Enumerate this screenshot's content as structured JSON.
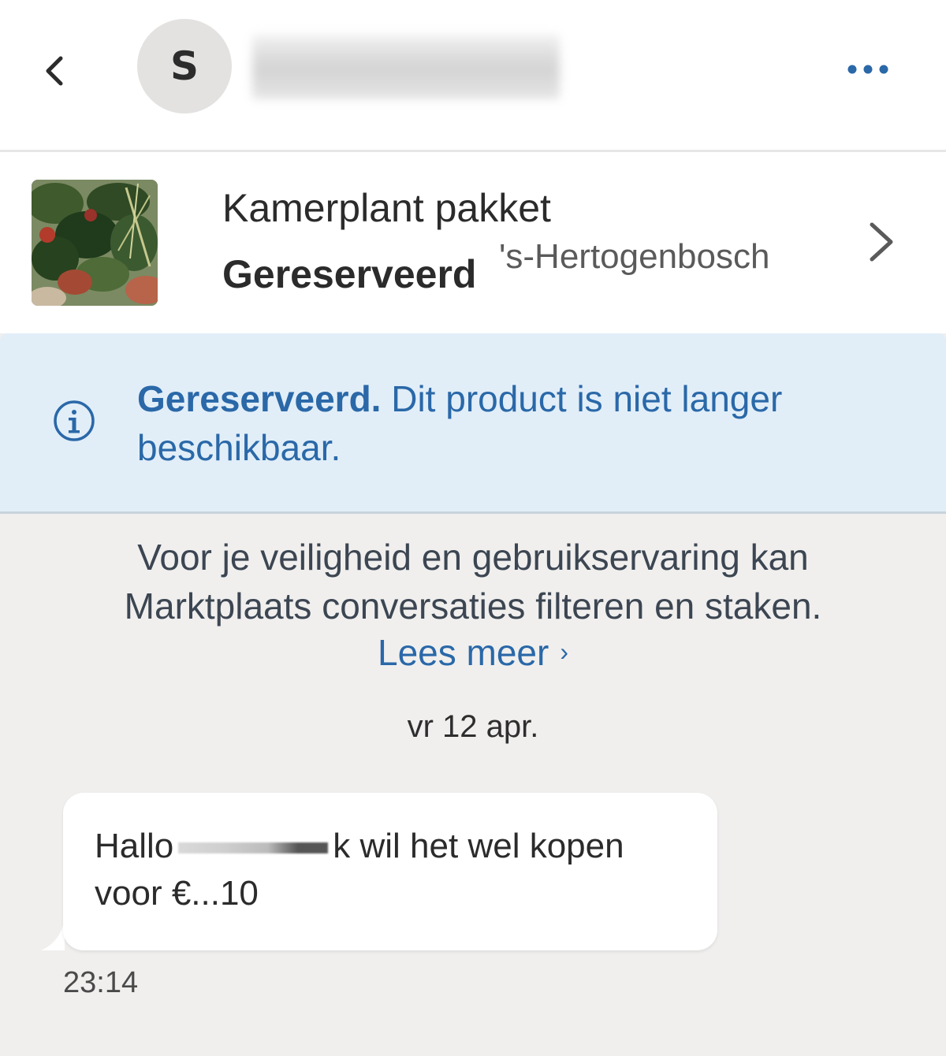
{
  "header": {
    "avatar_initial": "S",
    "back_icon": "chevron-left-icon",
    "more_icon": "more-horizontal-icon"
  },
  "listing": {
    "title": "Kamerplant pakket",
    "status": "Gereserveerd",
    "location": "'s-Hertogenbosch",
    "chevron_icon": "chevron-right-icon"
  },
  "info_banner": {
    "icon": "info-icon",
    "bold_text": "Gereserveerd.",
    "text": " Dit product is niet langer beschikbaar."
  },
  "notice": {
    "line1": "Voor je veiligheid en gebruikservaring kan",
    "line2": "Marktplaats conversaties filteren en staken.",
    "read_more": "Lees meer",
    "read_more_chevron": "›"
  },
  "conversation": {
    "date": "vr 12 apr.",
    "messages": [
      {
        "text_start": "Hallo",
        "text_end": "k wil het wel kopen",
        "line2": "voor €...10",
        "time": "23:14"
      }
    ]
  },
  "colors": {
    "accent": "#2a68a8",
    "banner_bg": "#e1eef8",
    "chat_bg": "#f0efee",
    "more_dots": "#2a68a8"
  }
}
